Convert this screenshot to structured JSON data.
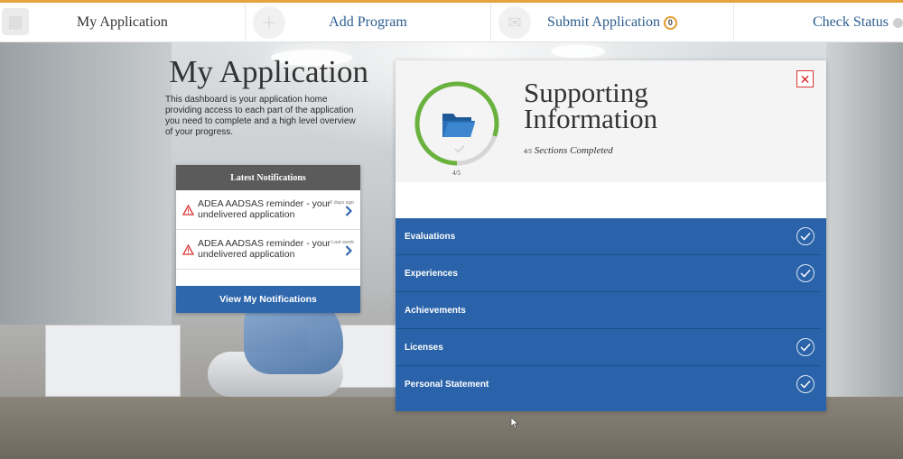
{
  "nav": {
    "items": [
      {
        "label": "My Application",
        "active": true
      },
      {
        "label": "Add Program",
        "active": false
      },
      {
        "label": "Submit Application",
        "badge": "0",
        "active": false
      },
      {
        "label": "Check Status",
        "active": false
      }
    ],
    "accent_color": "#e7a23a"
  },
  "intro": {
    "title": "My Application",
    "text": "This dashboard is your application home providing access to each part of the application you need to complete and a high level overview of your progress."
  },
  "notifications": {
    "header": "Latest Notifications",
    "items": [
      {
        "text": "ADEA AADSAS reminder - your undelivered application",
        "age": "2 days ago",
        "icon": "warning-icon"
      },
      {
        "text": "ADEA AADSAS reminder - your undelivered application",
        "age": "Last week",
        "icon": "warning-icon"
      }
    ],
    "button_label": "View My Notifications"
  },
  "panel": {
    "title": "Supporting Information",
    "subtitle_fraction": "4/5",
    "subtitle_text": "Sections Completed",
    "progress_label": "4/5",
    "progress_value": 0.8,
    "close_label": "✕",
    "icon": "folder-icon",
    "sections": [
      {
        "label": "Evaluations",
        "completed": true
      },
      {
        "label": "Experiences",
        "completed": true
      },
      {
        "label": "Achievements",
        "completed": false
      },
      {
        "label": "Licenses",
        "completed": true
      },
      {
        "label": "Personal Statement",
        "completed": true
      }
    ],
    "colors": {
      "section_bg": "#2a63a9",
      "progress_ring": "#6ab23e",
      "close": "#dd2222"
    }
  }
}
